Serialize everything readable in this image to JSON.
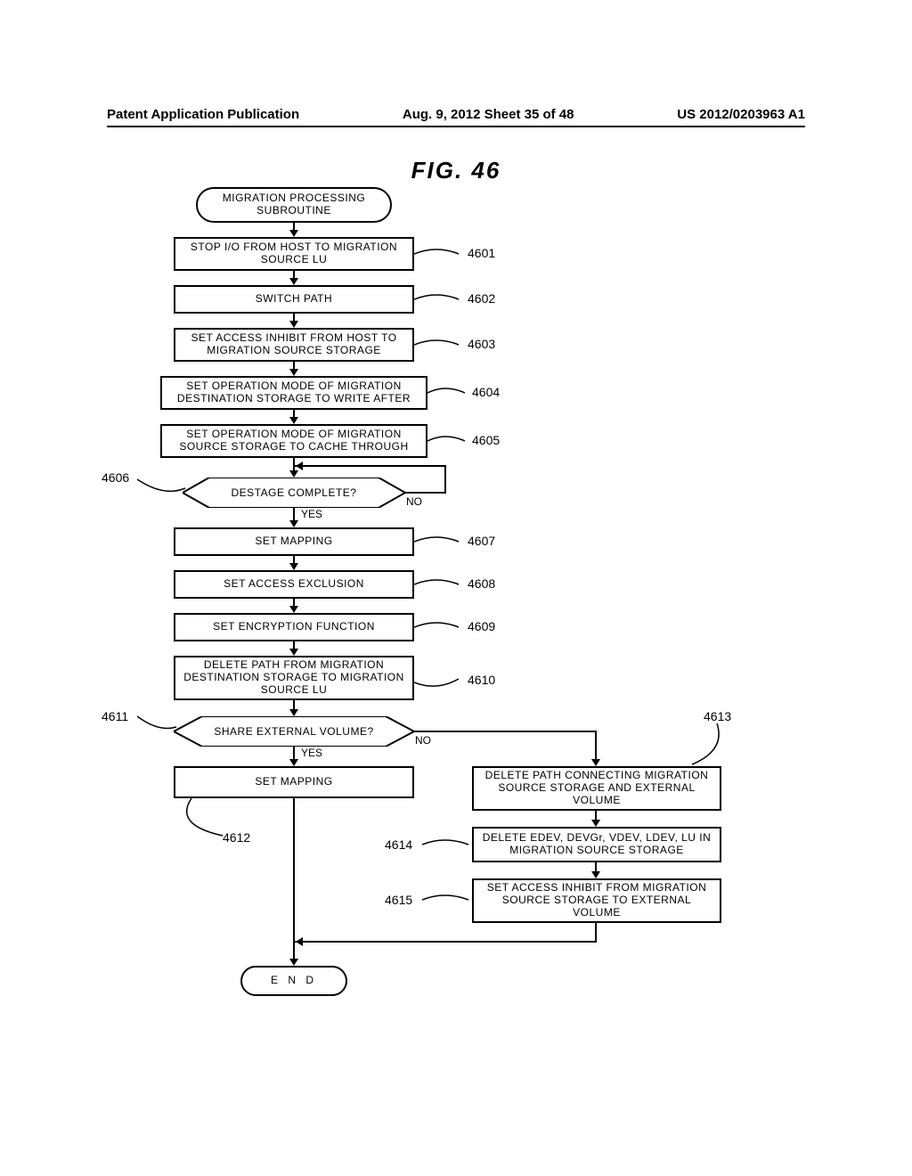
{
  "header": {
    "left": "Patent Application Publication",
    "center": "Aug. 9, 2012  Sheet 35 of 48",
    "right": "US 2012/0203963 A1"
  },
  "figure_title": "FIG. 46",
  "nodes": {
    "start": "MIGRATION PROCESSING SUBROUTINE",
    "s4601": "STOP I/O FROM HOST TO  MIGRATION SOURCE LU",
    "s4602": "SWITCH PATH",
    "s4603": "SET ACCESS INHIBIT FROM  HOST TO MIGRATION SOURCE  STORAGE",
    "s4604": "SET OPERATION MODE OF  MIGRATION DESTINATION  STORAGE TO WRITE AFTER",
    "s4605": "SET OPERATION MODE OF  MIGRATION SOURCE STORAGE  TO CACHE THROUGH",
    "d4606": "DESTAGE COMPLETE?",
    "s4607": "SET MAPPING",
    "s4608": "SET ACCESS EXCLUSION",
    "s4609": "SET ENCRYPTION FUNCTION",
    "s4610": "DELETE PATH FROM MIGRATION DESTINATION STORAGE TO MIGRATION SOURCE LU",
    "d4611": "SHARE EXTERNAL VOLUME?",
    "s4612": "SET MAPPING",
    "s4613": "DELETE PATH CONNECTING MIGRATION SOURCE STORAGE AND EXTERNAL VOLUME",
    "s4614": "DELETE EDEV, DEVGr, VDEV, LDEV, LU IN MIGRATION SOURCE STORAGE",
    "s4615": "SET ACCESS INHIBIT FROM MIGRATION  SOURCE STORAGE TO EXTERNAL VOLUME",
    "end": "E N D"
  },
  "labels": {
    "l4601": "4601",
    "l4602": "4602",
    "l4603": "4603",
    "l4604": "4604",
    "l4605": "4605",
    "l4606": "4606",
    "l4607": "4607",
    "l4608": "4608",
    "l4609": "4609",
    "l4610": "4610",
    "l4611": "4611",
    "l4612": "4612",
    "l4613": "4613",
    "l4614": "4614",
    "l4615": "4615",
    "yes": "YES",
    "no": "NO"
  }
}
